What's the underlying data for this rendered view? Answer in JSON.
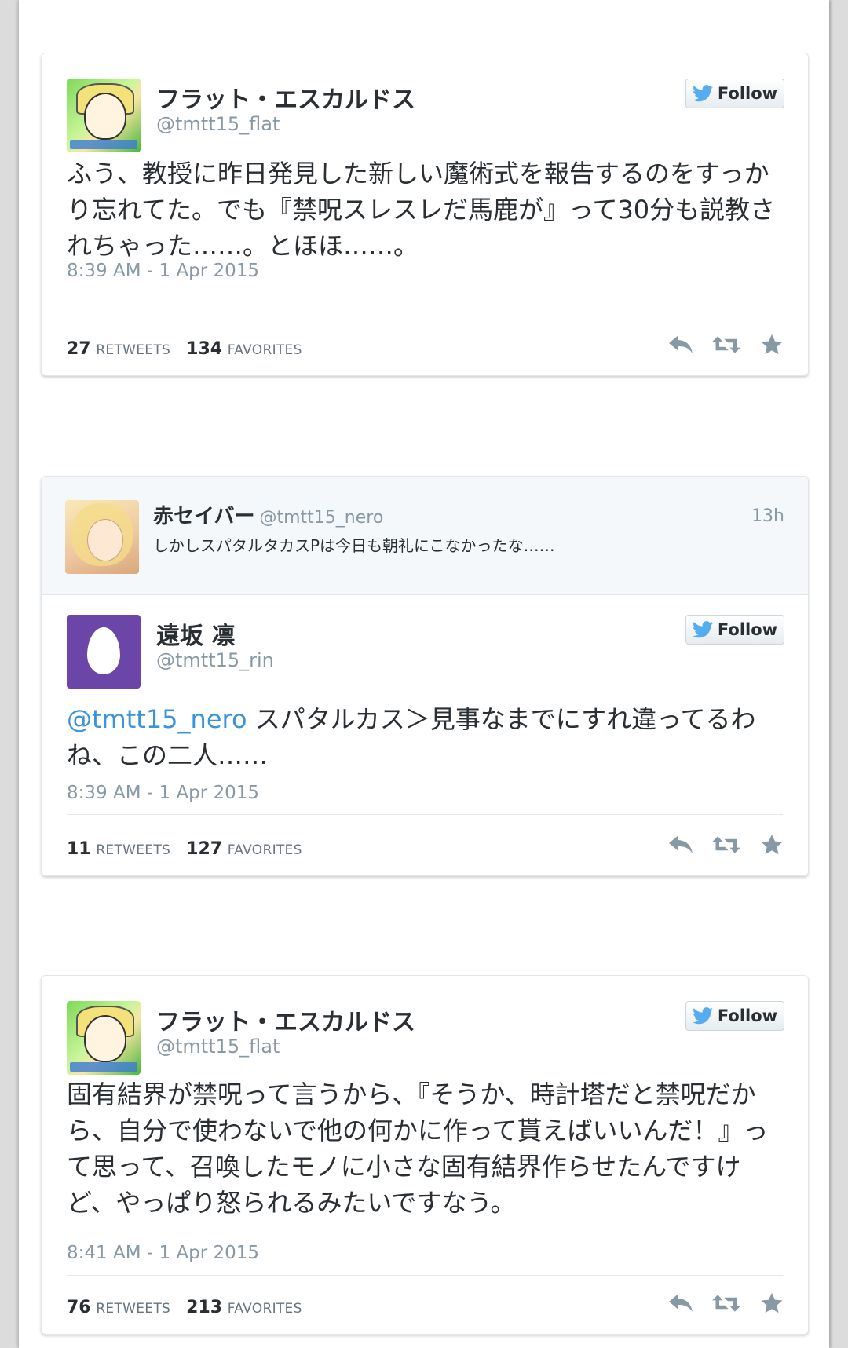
{
  "tweets": [
    {
      "name": "フラット・エスカルドス",
      "handle": "@tmtt15_flat",
      "follow_label": "Follow",
      "text": "ふう、教授に昨日発見した新しい魔術式を報告するのをすっかり忘れてた。でも『禁呪スレスレだ馬鹿が』って30分も説教されちゃった……。とほほ……。",
      "time": "8:39 AM - 1 Apr 2015",
      "retweets": "27",
      "retweets_label": "RETWEETS",
      "favorites": "134",
      "favorites_label": "FAVORITES"
    },
    {
      "reply_context": {
        "name": "赤セイバー",
        "handle": "@tmtt15_nero",
        "time": "13h",
        "text": "しかしスパタルタカスPは今日も朝礼にこなかったな……"
      },
      "name": "遠坂 凛",
      "handle": "@tmtt15_rin",
      "follow_label": "Follow",
      "mention": "@tmtt15_nero",
      "text": " スパタルカス＞見事なまでにすれ違ってるわね、この二人……",
      "time": "8:39 AM - 1 Apr 2015",
      "retweets": "11",
      "retweets_label": "RETWEETS",
      "favorites": "127",
      "favorites_label": "FAVORITES"
    },
    {
      "name": "フラット・エスカルドス",
      "handle": "@tmtt15_flat",
      "follow_label": "Follow",
      "text": "固有結界が禁呪って言うから、『そうか、時計塔だと禁呪だから、自分で使わないで他の何かに作って貰えばいいんだ！』って思って、召喚したモノに小さな固有結界作らせたんですけど、やっぱり怒られるみたいですなう。",
      "time": "8:41 AM - 1 Apr 2015",
      "retweets": "76",
      "retweets_label": "RETWEETS",
      "favorites": "213",
      "favorites_label": "FAVORITES"
    }
  ],
  "icons": [
    "twitter-bird-icon",
    "reply-icon",
    "retweet-icon",
    "favorite-star-icon"
  ],
  "colors": {
    "link": "#3b94d9",
    "muted": "#8899a6",
    "text": "#292f33",
    "egg_bg": "#6b46a8",
    "bird": "#55acee"
  }
}
